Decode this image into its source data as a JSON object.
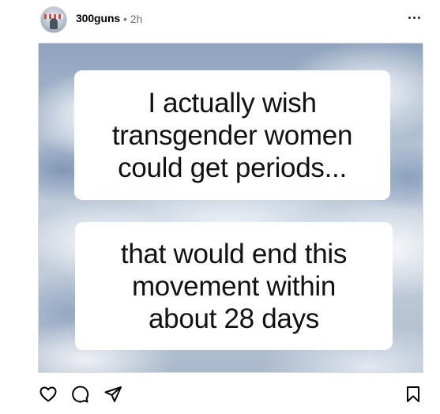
{
  "post": {
    "username": "300guns",
    "meta": "• 2h",
    "caption_top": "I actually wish\ntransgender women\ncould get periods...",
    "caption_bottom": "that would end this\nmovement within\nabout 28 days"
  },
  "icons": {
    "more": "more-options-icon",
    "like": "heart-icon",
    "comment": "comment-icon",
    "share": "share-icon",
    "save": "bookmark-icon"
  },
  "colors": {
    "meta_text": "#737373",
    "icon_stroke": "#000000"
  }
}
